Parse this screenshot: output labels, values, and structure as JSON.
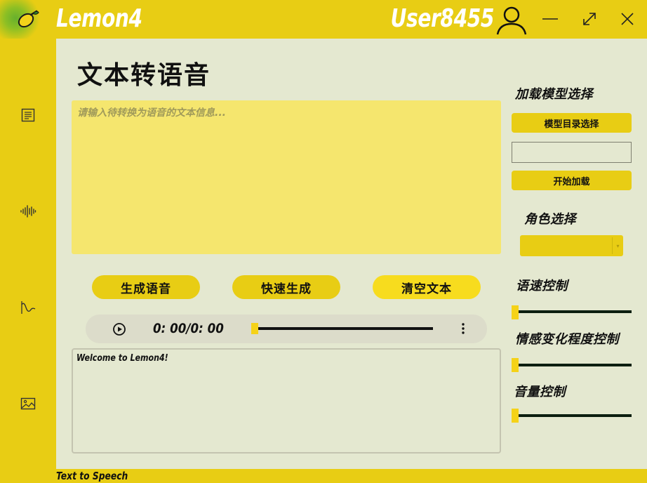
{
  "app": {
    "title": "Lemon4",
    "user": "User8455",
    "icons": [
      "lemon-logo-icon",
      "user-icon",
      "minimize-icon",
      "maximize-icon",
      "close-icon"
    ]
  },
  "sidebar": {
    "items": [
      {
        "icon": "document-icon"
      },
      {
        "icon": "audio-wave-icon"
      },
      {
        "icon": "curve-icon"
      },
      {
        "icon": "image-icon"
      }
    ]
  },
  "main": {
    "title": "文本转语音",
    "text_placeholder": "请输入待转换为语音的文本信息...",
    "buttons": {
      "generate": "生成语音",
      "quick": "快速生成",
      "clear": "清空文本"
    },
    "audio": {
      "time": "0: 00/0: 00",
      "progress": 0
    },
    "log": "Welcome to Lemon4!"
  },
  "right_panel": {
    "load_model_label": "加载模型选择",
    "model_dir_button": "模型目录选择",
    "model_path_value": "",
    "start_load_button": "开始加载",
    "role_label": "角色选择",
    "role_value": "",
    "speed_label": "语速控制",
    "speed_value": 0,
    "emotion_label": "情感变化程度控制",
    "emotion_value": 0,
    "volume_label": "音量控制",
    "volume_value": 0
  },
  "status": {
    "text": "Text to Speech"
  },
  "colors": {
    "accent": "#e8cd14",
    "main_bg": "#e4e8d0",
    "text_area": "#f5e66e",
    "slider_track": "#0c1f10"
  }
}
